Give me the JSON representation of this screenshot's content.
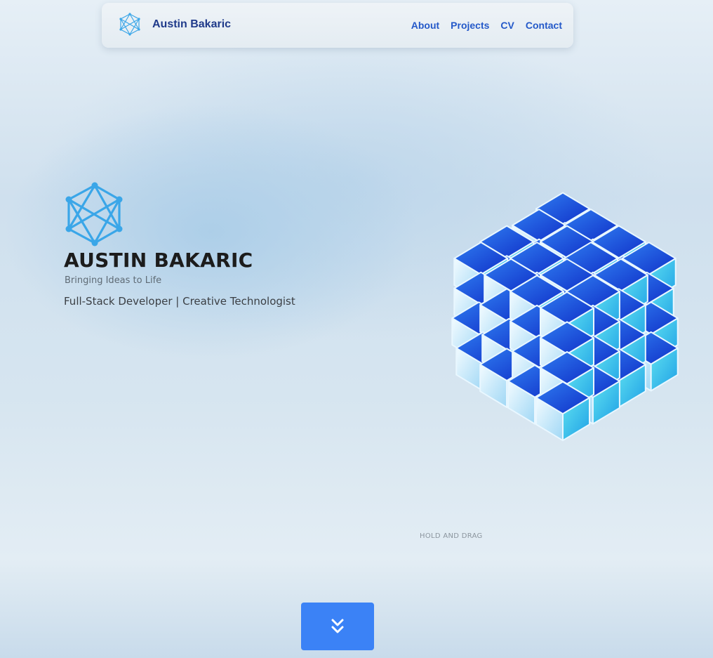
{
  "header": {
    "brand_name": "Austin Bakaric",
    "brand_icon": "network-polyhedron-icon",
    "nav": [
      {
        "label": "About"
      },
      {
        "label": "Projects"
      },
      {
        "label": "CV"
      },
      {
        "label": "Contact"
      }
    ]
  },
  "hero": {
    "title": "AUSTIN BAKARIC",
    "tagline": "Bringing Ideas to Life",
    "role": "Full-Stack Developer | Creative Technologist",
    "logo_icon": "network-polyhedron-icon"
  },
  "scene": {
    "hint": "HOLD AND DRAG",
    "object": "rotating-cube-cluster"
  },
  "scroll_button": {
    "icon": "double-chevron-down-icon"
  },
  "colors": {
    "accent": "#3b82f6",
    "nav_text": "#2459c9",
    "brand_text": "#1f3a8a",
    "title_text": "#1c1c1c",
    "cube_dark": "#1d4ed8",
    "cube_light": "#5ee0f0"
  }
}
